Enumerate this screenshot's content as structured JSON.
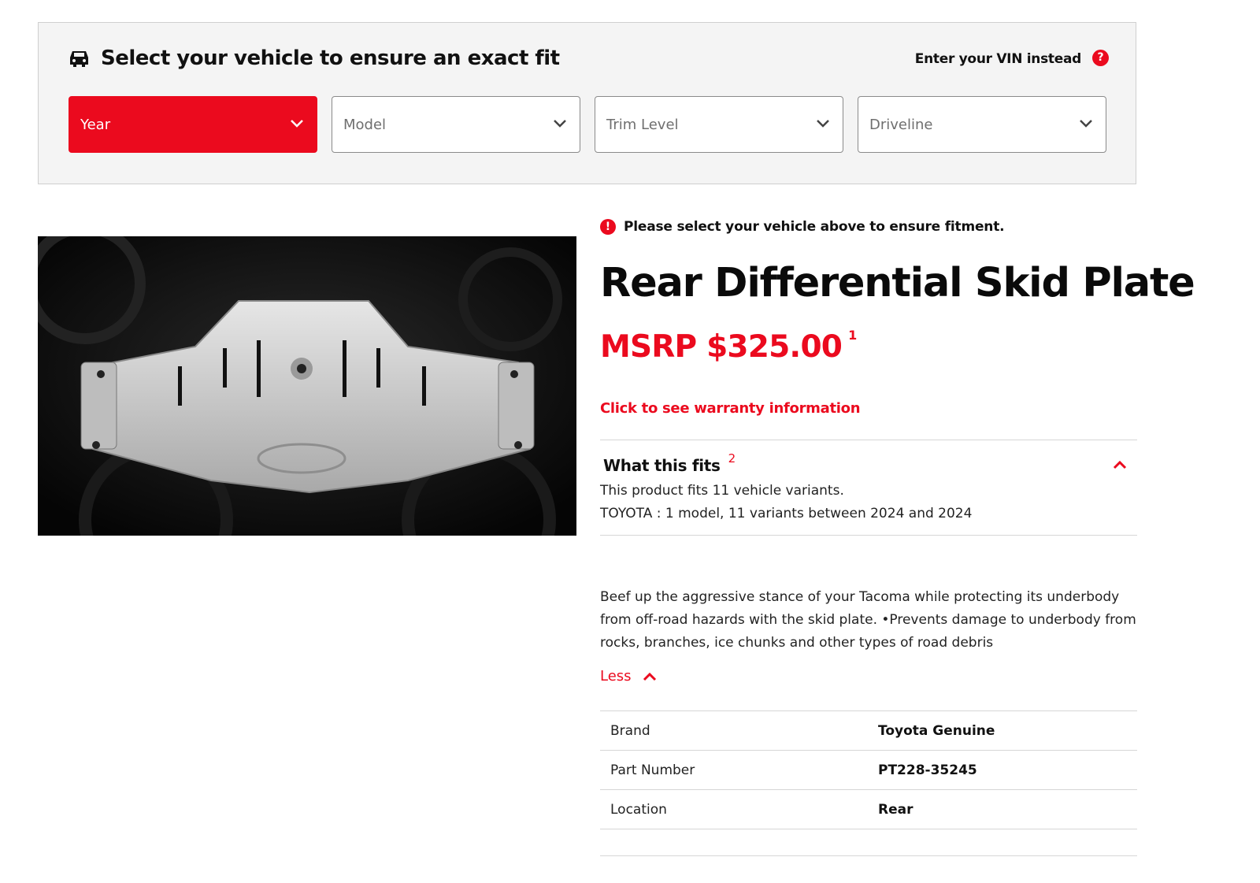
{
  "colors": {
    "accent": "#eb0a1e",
    "panel_bg": "#f4f4f4",
    "text": "#111111"
  },
  "selector": {
    "icon": "car-icon",
    "title": "Select your vehicle to ensure an exact fit",
    "vin_link": "Enter your VIN instead",
    "help_icon": "?",
    "dropdowns": [
      {
        "label": "Year",
        "active": true
      },
      {
        "label": "Model",
        "active": false
      },
      {
        "label": "Trim Level",
        "active": false
      },
      {
        "label": "Driveline",
        "active": false
      }
    ]
  },
  "product": {
    "alert_icon": "!",
    "alert": "Please select your vehicle above to ensure fitment.",
    "title": "Rear Differential Skid Plate",
    "price": "MSRP $325.00",
    "price_footnote": "1",
    "warranty_link": "Click to see warranty information",
    "fits": {
      "title": "What this fits",
      "footnote": "2",
      "line1": "This product fits 11 vehicle variants.",
      "line2": "TOYOTA : 1 model, 11 variants between 2024 and 2024"
    },
    "description": "Beef up the aggressive stance of your Tacoma while protecting its underbody from off-road hazards with the skid plate. •Prevents damage to underbody from rocks, branches, ice chunks and other types of road debris",
    "less_label": "Less",
    "specs": [
      {
        "label": "Brand",
        "value": "Toyota Genuine"
      },
      {
        "label": "Part Number",
        "value": "PT228-35245"
      },
      {
        "label": "Location",
        "value": "Rear"
      }
    ]
  }
}
